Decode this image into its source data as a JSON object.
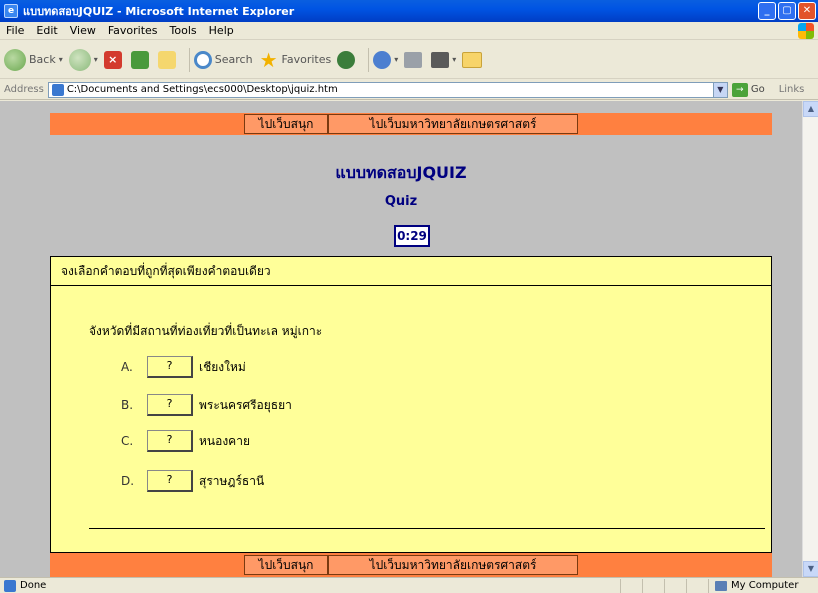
{
  "window": {
    "title": "แบบทดสอบJQUIZ - Microsoft Internet Explorer",
    "min": "_",
    "max": "▢",
    "close": "✕"
  },
  "menu": [
    "File",
    "Edit",
    "View",
    "Favorites",
    "Tools",
    "Help"
  ],
  "toolbar": {
    "back_label": "Back",
    "search_label": "Search",
    "favorites_label": "Favorites"
  },
  "address": {
    "label": "Address",
    "value": "C:\\Documents and Settings\\ecs000\\Desktop\\jquiz.htm",
    "go_label": "Go",
    "links_label": "Links"
  },
  "page": {
    "nav": {
      "fun_link": "ไปเว็บสนุก",
      "ku_link": "ไปเว็บมหาวิทยาลัยเกษตรศาสตร์"
    },
    "title": "แบบทดสอบJQUIZ",
    "subtitle": "Quiz",
    "timer": "0:29",
    "instructions": "จงเลือกคำตอบที่ถูกที่สุดเพียงคำตอบเดียว",
    "question": "จังหวัดที่มีสถานที่ท่องเที่ยวที่เป็นทะเล หมู่เกาะ",
    "options": [
      {
        "letter": "A.",
        "button": "?",
        "text": "เชียงใหม่"
      },
      {
        "letter": "B.",
        "button": "?",
        "text": "พระนครศรีอยุธยา"
      },
      {
        "letter": "C.",
        "button": "?",
        "text": "หนองคาย"
      },
      {
        "letter": "D.",
        "button": "?",
        "text": "สุราษฎร์ธานี"
      }
    ]
  },
  "status": {
    "left": "Done",
    "zone": "My Computer"
  },
  "colors": {
    "nav_bar": "#ff8040",
    "panel": "#ffff99",
    "title_text": "#000080",
    "page_bg": "#c0c0c0"
  }
}
